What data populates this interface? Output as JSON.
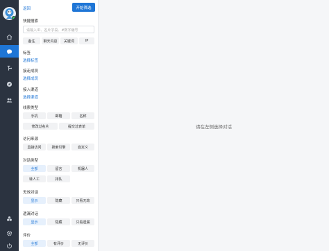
{
  "sidebar": {
    "icons": [
      "home-icon",
      "chat-icon",
      "route-icon",
      "compass-icon",
      "users-icon",
      "apps-icon",
      "settings-icon",
      "power-icon"
    ]
  },
  "filter": {
    "back_label": "返回",
    "start_label": "开始筛选",
    "quick_search": {
      "label": "快捷搜索",
      "placeholder": "请输入ID、名片字段、#数字编号",
      "chips": [
        "备注",
        "聊天内容",
        "关键词",
        "IP"
      ]
    },
    "tag": {
      "label": "标签",
      "link": "选择标签"
    },
    "member": {
      "label": "接走成员",
      "link": "选择成员"
    },
    "channel": {
      "label": "接入渠道",
      "link": "选择渠道"
    },
    "lead_type": {
      "label": "线索类型",
      "chips": [
        "手机",
        "邮箱",
        "名称",
        "修改过名片",
        "提交过表单"
      ]
    },
    "visit_source": {
      "label": "访问来源",
      "chips": [
        "直接访问",
        "搜索引擎",
        "自定义"
      ]
    },
    "dialog_type": {
      "label": "对话类型",
      "chips": [
        "全部",
        "留言",
        "机器人",
        "转人工",
        "排队"
      ]
    },
    "invalid_dialog": {
      "label": "无效对话",
      "chips": [
        "显示",
        "隐藏",
        "只看无效"
      ]
    },
    "blocked_dialog": {
      "label": "遗漏对话",
      "chips": [
        "显示",
        "隐藏",
        "只看遗漏"
      ]
    },
    "rating": {
      "label": "评价",
      "chips": [
        "全部",
        "有评价",
        "无评价"
      ]
    }
  },
  "main": {
    "empty_text": "请在左侧选择对话"
  },
  "colors": {
    "accent": "#1f76d6",
    "rail": "#2b3340"
  }
}
